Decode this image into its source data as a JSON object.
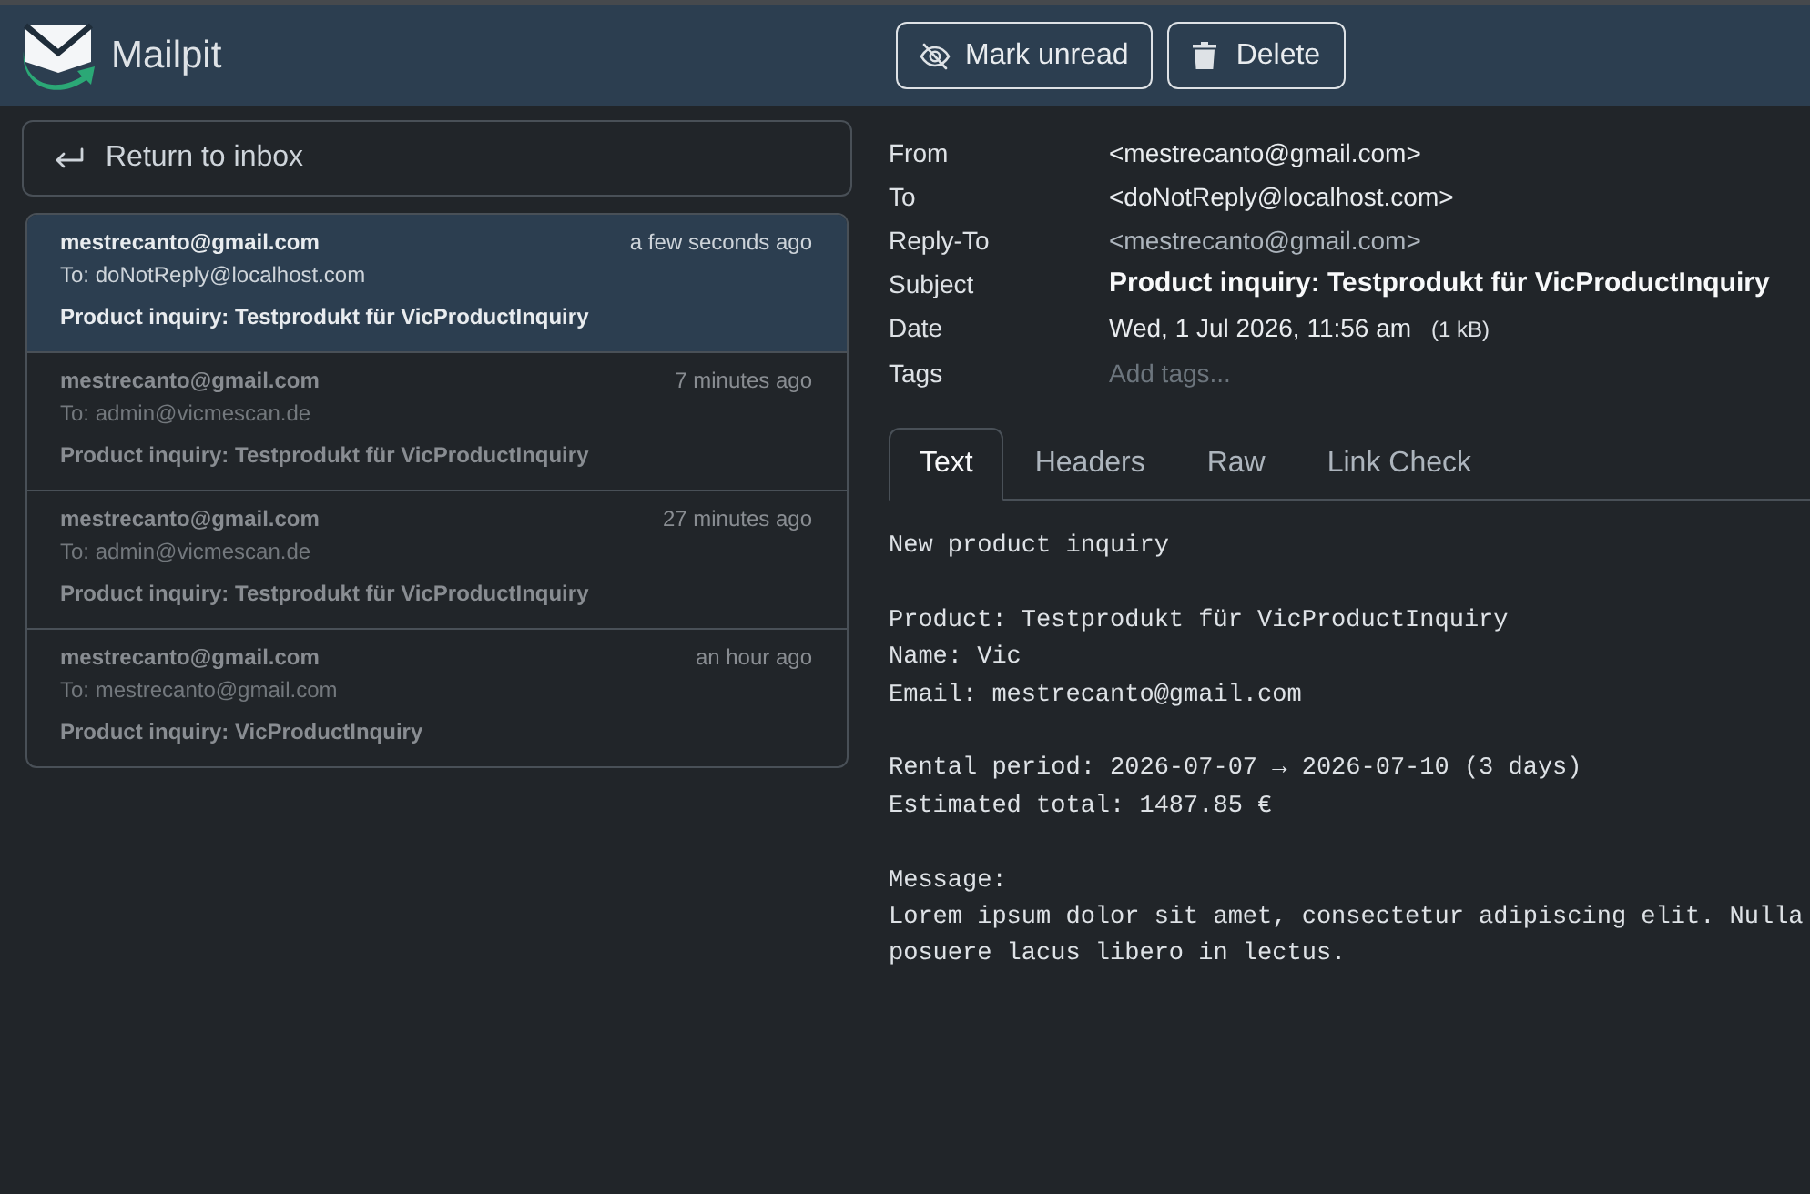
{
  "app": {
    "title": "Mailpit"
  },
  "toolbar": {
    "buttons": [
      {
        "label": "Mark unread",
        "kind": "mark_unread"
      },
      {
        "label": "Delete",
        "kind": "delete"
      }
    ]
  },
  "back_button": {
    "label": "Return to inbox"
  },
  "messages": [
    {
      "from": "mestrecanto@gmail.com",
      "to": "To: doNotReply@localhost.com",
      "subject": "Product inquiry: Testprodukt für VicProductInquiry",
      "time": "a few seconds ago",
      "selected": true
    },
    {
      "from": "mestrecanto@gmail.com",
      "to": "To: admin@vicmescan.de",
      "subject": "Product inquiry: Testprodukt für VicProductInquiry",
      "time": "7 minutes ago",
      "selected": false
    },
    {
      "from": "mestrecanto@gmail.com",
      "to": "To: admin@vicmescan.de",
      "subject": "Product inquiry: Testprodukt für VicProductInquiry",
      "time": "27 minutes ago",
      "selected": false
    },
    {
      "from": "mestrecanto@gmail.com",
      "to": "To: mestrecanto@gmail.com",
      "subject": "Product inquiry: VicProductInquiry",
      "time": "an hour ago",
      "selected": false
    }
  ],
  "headers": [
    {
      "label": "From",
      "kind": "address",
      "value": "<mestrecanto@gmail.com>"
    },
    {
      "label": "To",
      "kind": "address",
      "value": "<doNotReply@localhost.com>"
    },
    {
      "label": "Reply-To",
      "kind": "secondary",
      "value": "<mestrecanto@gmail.com>"
    },
    {
      "label": "Subject",
      "kind": "subject",
      "value": "Product inquiry: Testprodukt für VicProductInquiry"
    },
    {
      "label": "Date",
      "kind": "date",
      "value": "Wed, 1 Jul 2026, 11:56 am",
      "size": "(1 kB)"
    },
    {
      "label": "Tags",
      "kind": "tags",
      "placeholder": "Add tags..."
    }
  ],
  "tabs": [
    {
      "label": "Text",
      "selected": true
    },
    {
      "label": "Headers",
      "selected": false
    },
    {
      "label": "Raw",
      "selected": false
    },
    {
      "label": "Link Check",
      "selected": false
    }
  ],
  "body": {
    "paragraphs": [
      [
        "New product inquiry"
      ],
      [
        "Product: Testprodukt für VicProductInquiry",
        "Name: Vic",
        "Email: mestrecanto@gmail.com"
      ],
      [
        "Rental period: 2026-07-07 → 2026-07-10 (3 days)",
        "Estimated total: 1487.85 €"
      ],
      [
        "Message:",
        "Lorem ipsum dolor sit amet, consectetur adipiscing elit. Nulla",
        "posuere lacus libero in lectus."
      ]
    ]
  }
}
